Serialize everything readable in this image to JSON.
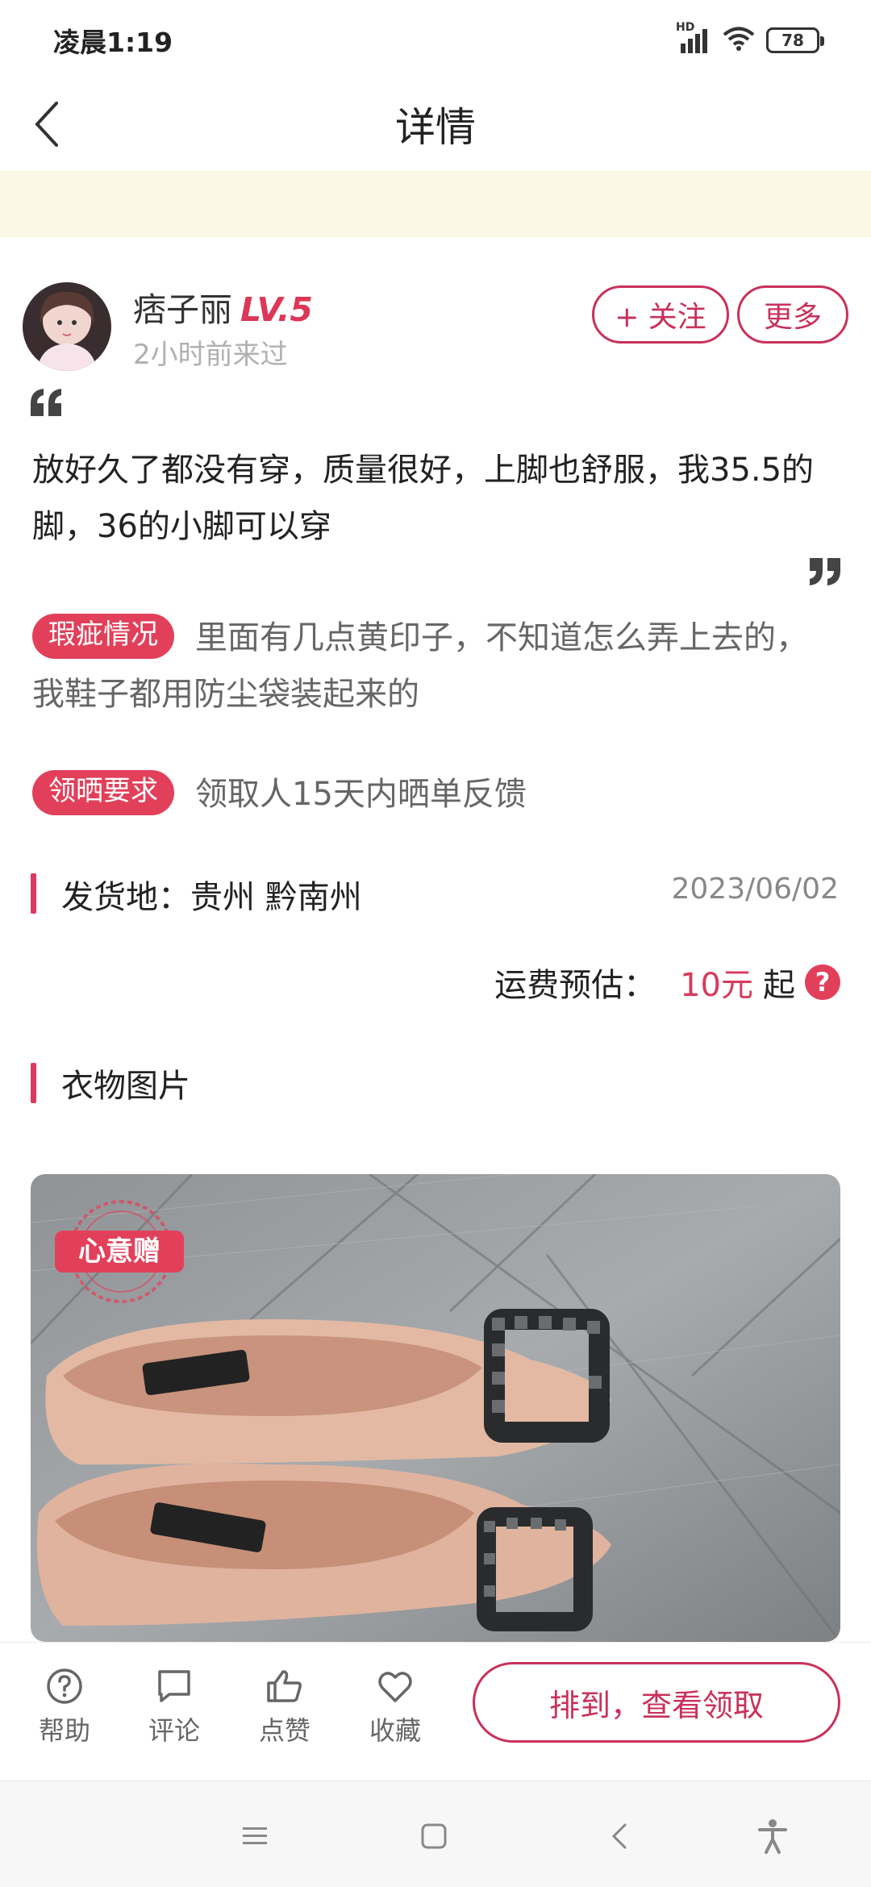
{
  "status_bar": {
    "time": "凌晨1:19",
    "network": "HD",
    "battery": "78"
  },
  "header": {
    "title": "详情",
    "back_icon": "chevron-left-icon"
  },
  "user": {
    "name": "痞子丽",
    "level": "LV.5",
    "last_seen": "2小时前来过",
    "follow_label": "+ 关注",
    "more_label": "更多"
  },
  "post": {
    "description": "放好久了都没有穿，质量很好，上脚也舒服，我35.5的脚，36的小脚可以穿",
    "defect_tag": "瑕疵情况",
    "defect_text": "里面有几点黄印子，不知道怎么弄上去的，我鞋子都用防尘袋装起来的",
    "requirement_tag": "领晒要求",
    "requirement_text": "领取人15天内晒单反馈",
    "ship_from": "发货地：贵州 黔南州",
    "date": "2023/06/02",
    "shipping_label": "运费预估：",
    "shipping_price": "10元",
    "shipping_suffix": "起",
    "shipping_help": "?",
    "photo_section_title": "衣物图片",
    "gift_badge": "心意赠"
  },
  "actions": {
    "help": "帮助",
    "comment": "评论",
    "like": "点赞",
    "favorite": "收藏",
    "claim": "排到，查看领取"
  },
  "colors": {
    "accent": "#d93a5d",
    "banner": "#fcf8e8"
  }
}
